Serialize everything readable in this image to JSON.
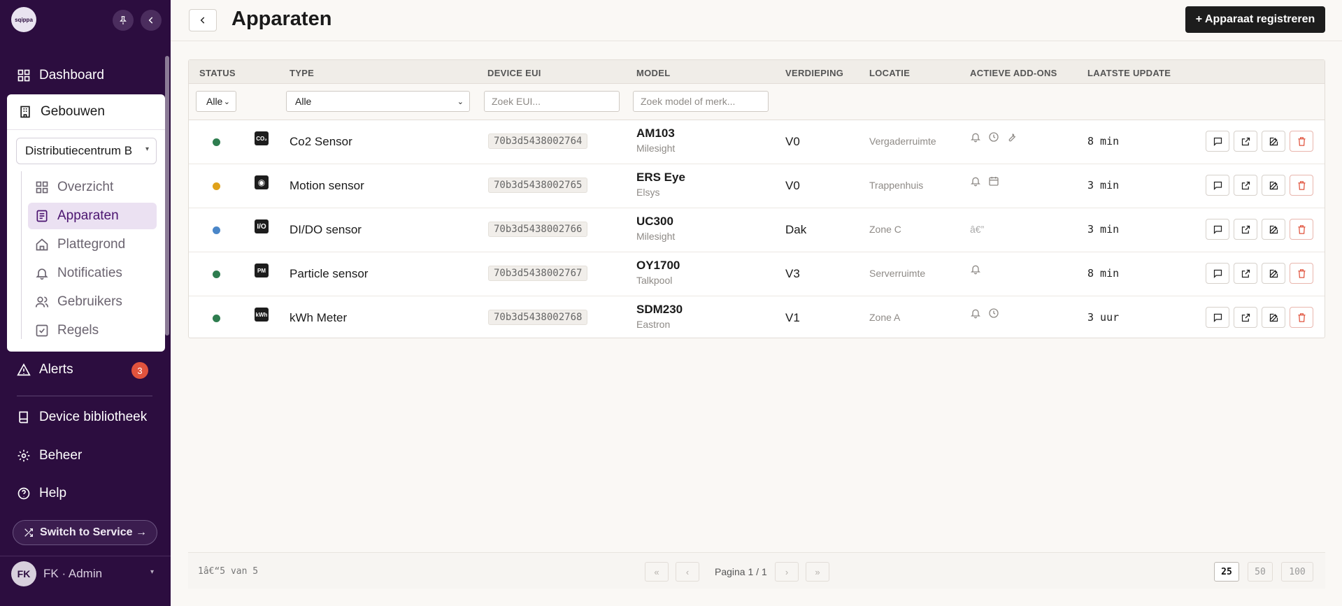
{
  "app": {
    "logo_text": "sqippa"
  },
  "sidebar": {
    "dashboard": "Dashboard",
    "buildings_label": "Gebouwen",
    "building_select": "Distributiecentrum B",
    "sub_items": [
      {
        "label": "Overzicht",
        "icon": "grid-icon"
      },
      {
        "label": "Apparaten",
        "icon": "list-icon",
        "active": true
      },
      {
        "label": "Plattegrond",
        "icon": "home-icon"
      },
      {
        "label": "Notificaties",
        "icon": "bell-icon"
      },
      {
        "label": "Gebruikers",
        "icon": "users-icon"
      },
      {
        "label": "Regels",
        "icon": "checkbox-icon"
      }
    ],
    "alerts_label": "Alerts",
    "alerts_count": "3",
    "device_library": "Device bibliotheek",
    "management": "Beheer",
    "help": "Help",
    "switch_label": "Switch to Service →",
    "user_initials": "FK",
    "user_name": "FK · Admin"
  },
  "header": {
    "title": "Apparaten",
    "register_button": "+ Apparaat registreren"
  },
  "table": {
    "columns": [
      "STATUS",
      "TYPE",
      "DEVICE EUI",
      "MODEL",
      "VERDIEPING",
      "LOCATIE",
      "ACTIEVE ADD-ONS",
      "LAATSTE UPDATE"
    ],
    "filters": {
      "status": "Alle",
      "type": "Alle",
      "eui_placeholder": "Zoek EUI...",
      "model_placeholder": "Zoek model of merk..."
    },
    "rows": [
      {
        "status_color": "#2e7d4f",
        "type_icon": "CO₂",
        "type": "Co2 Sensor",
        "eui": "70b3d5438002764",
        "model": "AM103",
        "brand": "Milesight",
        "floor": "V0",
        "location": "Vergaderruimte",
        "addons": [
          "bell-icon",
          "clock-icon",
          "wrench-icon"
        ],
        "update": "8 min"
      },
      {
        "status_color": "#e0a21a",
        "type_icon": "◉",
        "type": "Motion sensor",
        "eui": "70b3d5438002765",
        "model": "ERS Eye",
        "brand": "Elsys",
        "floor": "V0",
        "location": "Trappenhuis",
        "addons": [
          "bell-icon",
          "calendar-icon"
        ],
        "update": "3 min"
      },
      {
        "status_color": "#4a86c8",
        "type_icon": "I/O",
        "type": "DI/DO sensor",
        "eui": "70b3d5438002766",
        "model": "UC300",
        "brand": "Milesight",
        "floor": "Dak",
        "location": "Zone C",
        "addons_text": "â€”",
        "update": "3 min"
      },
      {
        "status_color": "#2e7d4f",
        "type_icon": "PM",
        "type": "Particle sensor",
        "eui": "70b3d5438002767",
        "model": "OY1700",
        "brand": "Talkpool",
        "floor": "V3",
        "location": "Serverruimte",
        "addons": [
          "bell-icon"
        ],
        "update": "8 min"
      },
      {
        "status_color": "#2e7d4f",
        "type_icon": "kWh",
        "type": "kWh Meter",
        "eui": "70b3d5438002768",
        "model": "SDM230",
        "brand": "Eastron",
        "floor": "V1",
        "location": "Zone A",
        "addons": [
          "bell-icon",
          "clock-icon"
        ],
        "update": "3 uur"
      }
    ]
  },
  "footer": {
    "count": "1â€“5 van 5",
    "page_label": "Pagina 1 / 1",
    "first": "«",
    "prev": "‹",
    "next": "›",
    "last": "»",
    "sizes": [
      "25",
      "50",
      "100"
    ],
    "active_size": "25"
  },
  "colors": {
    "sidebar_bg": "#2c0d3f",
    "active_bg": "#ebe1f2",
    "delete": "#e0533d",
    "primary_button": "#1d1d1d"
  }
}
